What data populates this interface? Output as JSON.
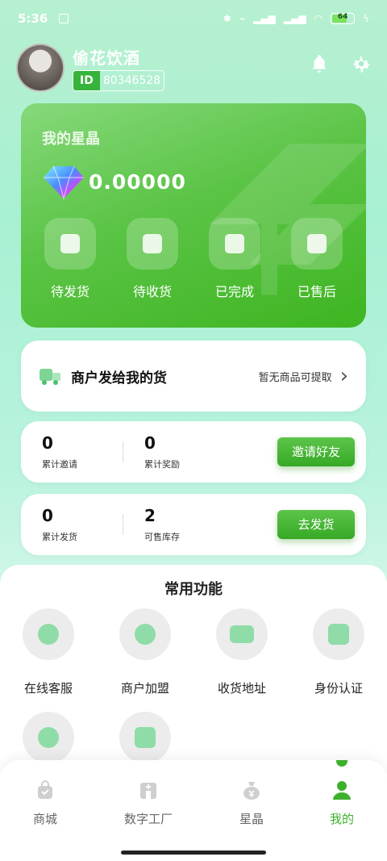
{
  "status_bar": {
    "time": "5:36",
    "battery": "64",
    "icons": [
      "bluetooth-icon",
      "vibrate-icon",
      "signal-icon",
      "signal-icon",
      "wifi-icon",
      "charging-icon"
    ]
  },
  "profile": {
    "username": "偷花饮酒",
    "id_tag": "ID",
    "id_value": "80346528"
  },
  "crystal": {
    "title": "我的星晶",
    "balance": "0.00000",
    "orders": [
      {
        "label": "待发货",
        "icon": "pending-shipment-icon"
      },
      {
        "label": "待收货",
        "icon": "pending-receipt-icon"
      },
      {
        "label": "已完成",
        "icon": "completed-icon"
      },
      {
        "label": "已售后",
        "icon": "after-sales-icon"
      }
    ]
  },
  "merchant": {
    "title": "商户发给我的货",
    "status": "暂无商品可提取"
  },
  "invite_stats": {
    "invites_value": "0",
    "invites_label": "累计邀请",
    "rewards_value": "0",
    "rewards_label": "累计奖励",
    "button": "邀请好友"
  },
  "ship_stats": {
    "shipped_value": "0",
    "shipped_label": "累计发货",
    "stock_value": "2",
    "stock_label": "可售库存",
    "button": "去发货"
  },
  "functions": {
    "title": "常用功能",
    "items": [
      {
        "label": "在线客服",
        "icon": "chat-icon"
      },
      {
        "label": "商户加盟",
        "icon": "badge-icon"
      },
      {
        "label": "收货地址",
        "icon": "location-icon"
      },
      {
        "label": "身份认证",
        "icon": "id-card-icon"
      },
      {
        "label": "",
        "icon": "message-icon"
      },
      {
        "label": "",
        "icon": "upload-icon"
      }
    ]
  },
  "tabbar": {
    "items": [
      {
        "label": "商城",
        "icon": "shopping-bag-icon"
      },
      {
        "label": "数字工厂",
        "icon": "factory-icon"
      },
      {
        "label": "星晶",
        "icon": "money-bag-icon"
      },
      {
        "label": "我的",
        "icon": "person-icon"
      }
    ],
    "active": "我的"
  },
  "colors": {
    "accent": "#3eb02d",
    "card_green": "#5bc446",
    "background": "#b6f0d0"
  }
}
